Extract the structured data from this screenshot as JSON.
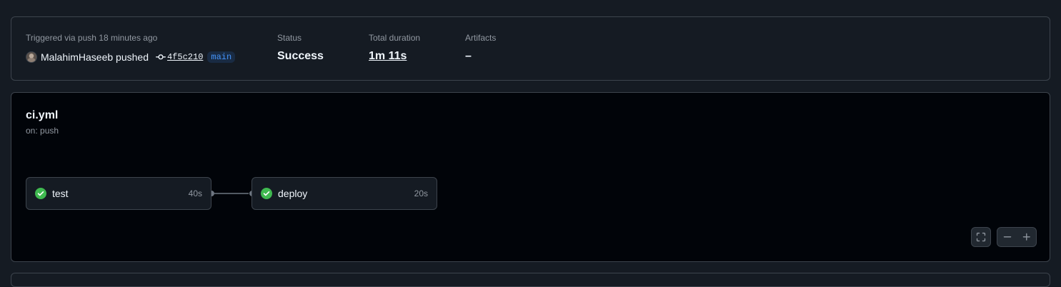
{
  "summary": {
    "trigger_label": "Triggered via push 18 minutes ago",
    "actor": "MalahimHaseeb pushed",
    "commit_sha": "4f5c210",
    "branch": "main",
    "status_label": "Status",
    "status_value": "Success",
    "duration_label": "Total duration",
    "duration_value": "1m 11s",
    "artifacts_label": "Artifacts",
    "artifacts_value": "–"
  },
  "workflow": {
    "title": "ci.yml",
    "trigger": "on: push",
    "jobs": [
      {
        "name": "test",
        "duration": "40s",
        "status": "success"
      },
      {
        "name": "deploy",
        "duration": "20s",
        "status": "success"
      }
    ]
  },
  "controls": {
    "fullscreen_icon": "fullscreen-icon",
    "zoom_out_icon": "minus-icon",
    "zoom_in_icon": "plus-icon"
  },
  "colors": {
    "success": "#3fb950",
    "link": "#4493f8"
  }
}
